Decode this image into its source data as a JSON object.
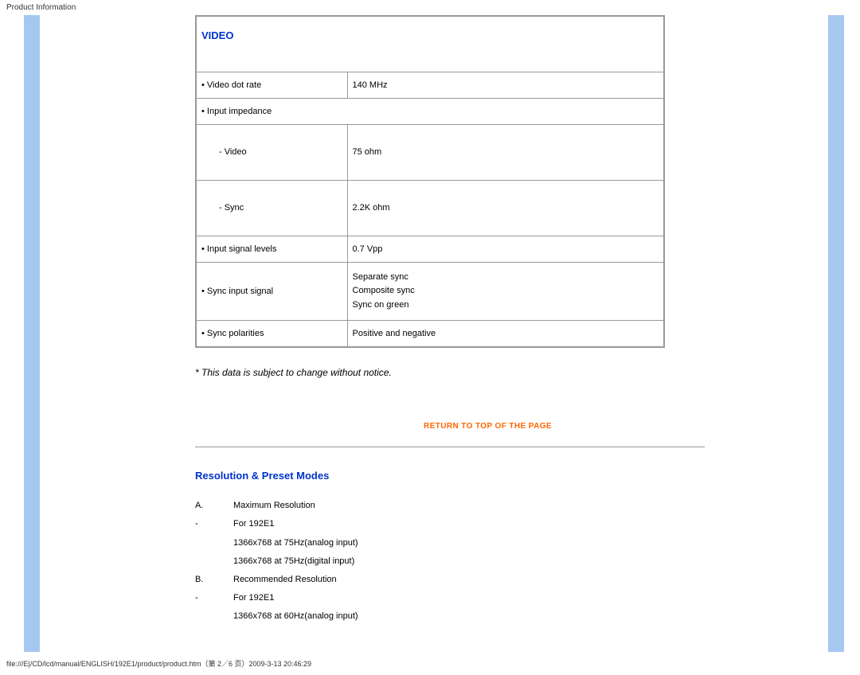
{
  "header": {
    "title": "Product Information"
  },
  "video": {
    "title": "VIDEO",
    "rows": [
      {
        "label": "• Video dot rate",
        "value": "140 MHz"
      },
      {
        "label": "• Input impedance",
        "value": ""
      },
      {
        "label": "- Video",
        "value": "75 ohm"
      },
      {
        "label": "- Sync",
        "value": "2.2K ohm"
      },
      {
        "label": "• Input signal levels",
        "value": "0.7 Vpp"
      },
      {
        "label": "• Sync input signal",
        "value": "Separate sync\nComposite sync\nSync on green"
      },
      {
        "label": "• Sync polarities",
        "value": "Positive and negative"
      }
    ]
  },
  "notice": "* This data is subject to change without notice.",
  "return_link": "RETURN TO TOP OF THE PAGE",
  "resolution": {
    "title": "Resolution & Preset Modes",
    "items": [
      {
        "letter": "A.",
        "text": "Maximum Resolution"
      },
      {
        "letter": "-",
        "text": "For 192E1"
      },
      {
        "letter": "",
        "text": "1366x768 at 75Hz(analog input)"
      },
      {
        "letter": "",
        "text": "1366x768 at 75Hz(digital input)"
      },
      {
        "letter": "B.",
        "text": "Recommended Resolution"
      },
      {
        "letter": "-",
        "text": "For 192E1"
      },
      {
        "letter": "",
        "text": "1366x768 at 60Hz(analog input)"
      }
    ]
  },
  "footer": "file:///E|/CD/lcd/manual/ENGLISH/192E1/product/product.htm（第 2／6 页）2009-3-13 20:46:29"
}
